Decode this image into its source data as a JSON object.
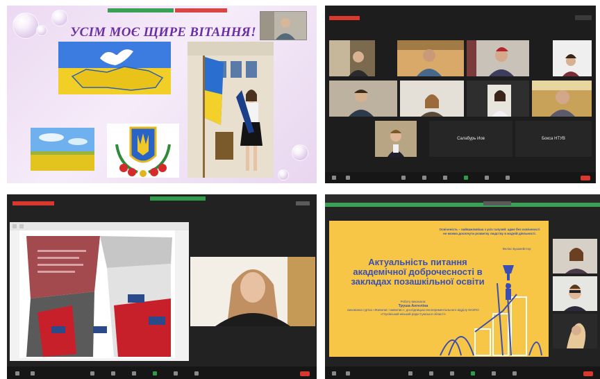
{
  "panel_top_left": {
    "slide_title": "УСІМ МОЄ ЩИРЕ ВІТАННЯ!"
  },
  "panel_top_right": {
    "name_tiles": [
      "Салабурь Иов",
      "Бокса НТУВ"
    ]
  },
  "panel_bottom_right": {
    "slide_quote": "Освіченість – найважливіша з усіх галузей: адже без освіченості не можна досягнути розвитку людству в жодній діяльності.",
    "slide_quote_author": "Фелікс Бушмейстер",
    "slide_title": "Актуальність питання академічної доброчесності в закладах позашкільної освіти",
    "author_line1": "Роботу виконала:",
    "author_name": "Труша Ангеліна",
    "author_desc": "вихованка гуртка «Живопис і живопис»; дослідницько-експериментального відділу КНЗПО «Глухівський міський ради Сумської області»"
  },
  "colors": {
    "ukraine_blue": "#2b6fd6",
    "ukraine_yellow": "#f5d20f",
    "zoom_dark": "#1d1d1d",
    "slide_yellow": "#f7c646",
    "title_purple": "#6a2fa6",
    "leave_red": "#d9382f"
  }
}
